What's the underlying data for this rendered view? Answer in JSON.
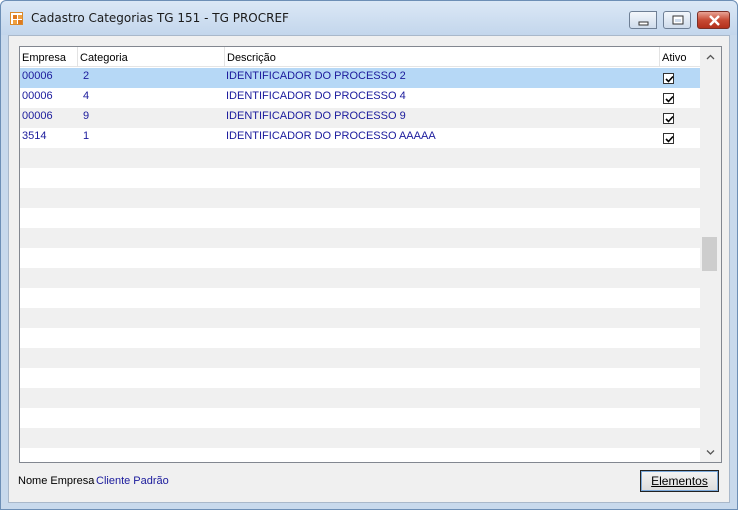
{
  "window": {
    "title": "Cadastro Categorias TG 151 - TG PROCREF",
    "icon": "app-logo-icon",
    "controls": [
      "minimize-icon",
      "maximize-icon",
      "close-icon"
    ]
  },
  "grid": {
    "columns": [
      "Empresa",
      "Categoria",
      "Descrição",
      "Ativo"
    ],
    "rows": [
      {
        "empresa": "00006",
        "categoria": "2",
        "descricao": "IDENTIFICADOR DO PROCESSO 2",
        "ativo": true,
        "selected": true
      },
      {
        "empresa": "00006",
        "categoria": "4",
        "descricao": "IDENTIFICADOR DO PROCESSO 4",
        "ativo": true,
        "selected": false
      },
      {
        "empresa": "00006",
        "categoria": "9",
        "descricao": "IDENTIFICADOR DO PROCESSO 9",
        "ativo": true,
        "selected": false
      },
      {
        "empresa": "3514",
        "categoria": "1",
        "descricao": "IDENTIFICADOR DO PROCESSO AAAAA",
        "ativo": true,
        "selected": false
      }
    ],
    "empty_rows": 16
  },
  "footer": {
    "label": "Nome Empresa",
    "value": "Cliente Padrão"
  },
  "buttons": {
    "elementos": "Elementos"
  },
  "colors": {
    "selected_row": "#b6d8f6",
    "data_text": "#1a1a9c",
    "alt_row": "#f0f0f0"
  }
}
